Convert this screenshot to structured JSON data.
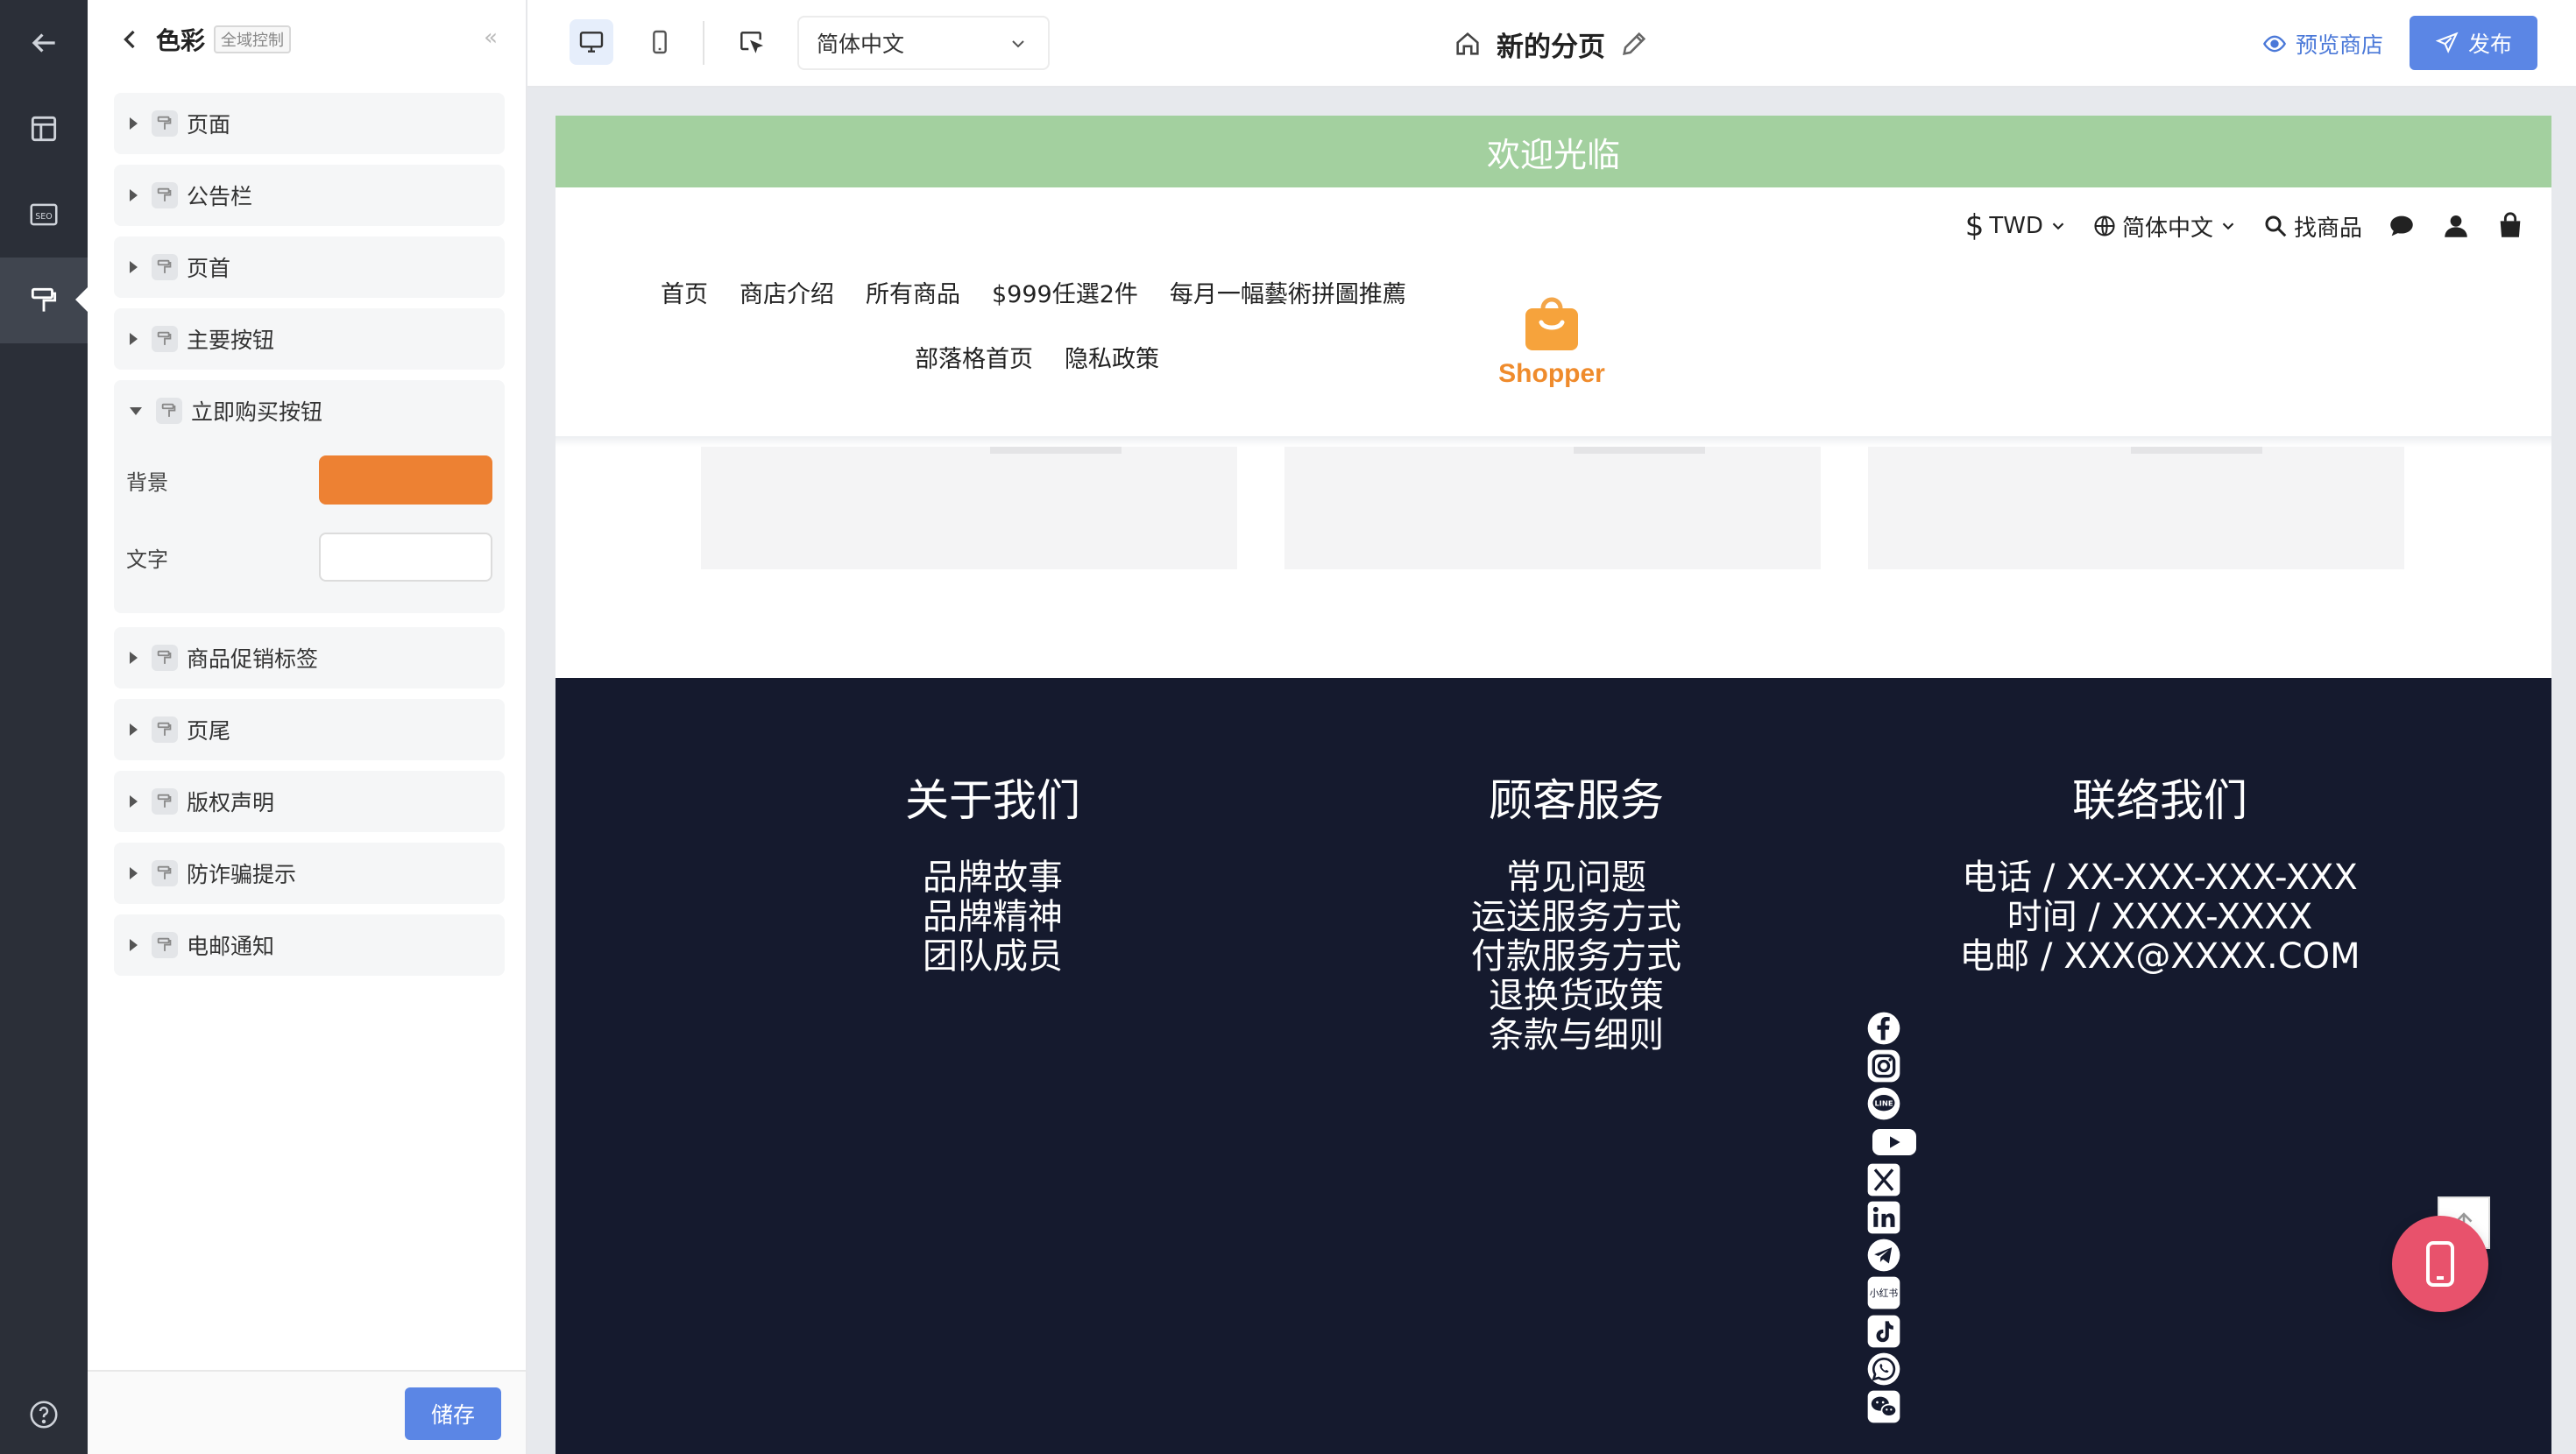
{
  "rail": {
    "items": [
      {
        "icon": "back-arrow-icon"
      },
      {
        "icon": "layout-icon"
      },
      {
        "icon": "seo-icon",
        "label": "SEO"
      },
      {
        "icon": "paint-roller-icon"
      },
      {
        "icon": "help-icon"
      }
    ]
  },
  "panel": {
    "title": "色彩",
    "scope_tag": "全域控制",
    "collapse_glyph": "«",
    "sections": [
      {
        "label": "页面",
        "expanded": false
      },
      {
        "label": "公告栏",
        "expanded": false
      },
      {
        "label": "页首",
        "expanded": false
      },
      {
        "label": "主要按钮",
        "expanded": false
      },
      {
        "label": "立即购买按钮",
        "expanded": true,
        "fields": [
          {
            "label": "背景",
            "color": "#ed8133"
          },
          {
            "label": "文字",
            "color": "#ffffff"
          }
        ]
      },
      {
        "label": "商品促销标签",
        "expanded": false
      },
      {
        "label": "页尾",
        "expanded": false
      },
      {
        "label": "版权声明",
        "expanded": false
      },
      {
        "label": "防诈骗提示",
        "expanded": false
      },
      {
        "label": "电邮通知",
        "expanded": false
      }
    ],
    "save_label": "储存"
  },
  "toolbar": {
    "language_selected": "简体中文",
    "page_name": "新的分页",
    "preview_label": "预览商店",
    "publish_label": "发布"
  },
  "store": {
    "announcement": "欢迎光临",
    "currency_symbol": "$",
    "currency": "TWD",
    "language": "简体中文",
    "search_label": "找商品",
    "nav_row1": [
      "首页",
      "商店介绍",
      "所有商品",
      "$999任選2件",
      "每月一幅藝術拼圖推薦"
    ],
    "nav_row2": [
      "部落格首页",
      "隐私政策"
    ],
    "brand": "Shopper",
    "footer": {
      "col1": {
        "title": "关于我们",
        "lines": [
          "品牌故事",
          "品牌精神",
          "团队成员"
        ]
      },
      "col2": {
        "title": "顾客服务",
        "lines": [
          "常见问题",
          "运送服务方式",
          "付款服务方式",
          "退换货政策",
          "条款与细则"
        ]
      },
      "col3": {
        "title": "联络我们",
        "lines": [
          "电话 / XX-XXX-XXX-XXX",
          "时间 / XXXX-XXXX",
          "电邮 / XXX@XXXX.COM"
        ]
      },
      "socials": [
        "facebook-icon",
        "instagram-icon",
        "line-icon",
        "youtube-icon",
        "x-icon",
        "linkedin-icon",
        "telegram-icon",
        "xiaohongshu-icon",
        "tiktok-icon",
        "whatsapp-icon",
        "wechat-icon"
      ],
      "xiaohongshu_text": "小红书",
      "line_text": "LINE"
    }
  },
  "colors": {
    "accent": "#5b86e5",
    "announcement_bg": "#a3d09f",
    "footer_bg": "#151a2e",
    "brand_orange": "#ef8b2c",
    "fab_pink": "#e8526c"
  }
}
